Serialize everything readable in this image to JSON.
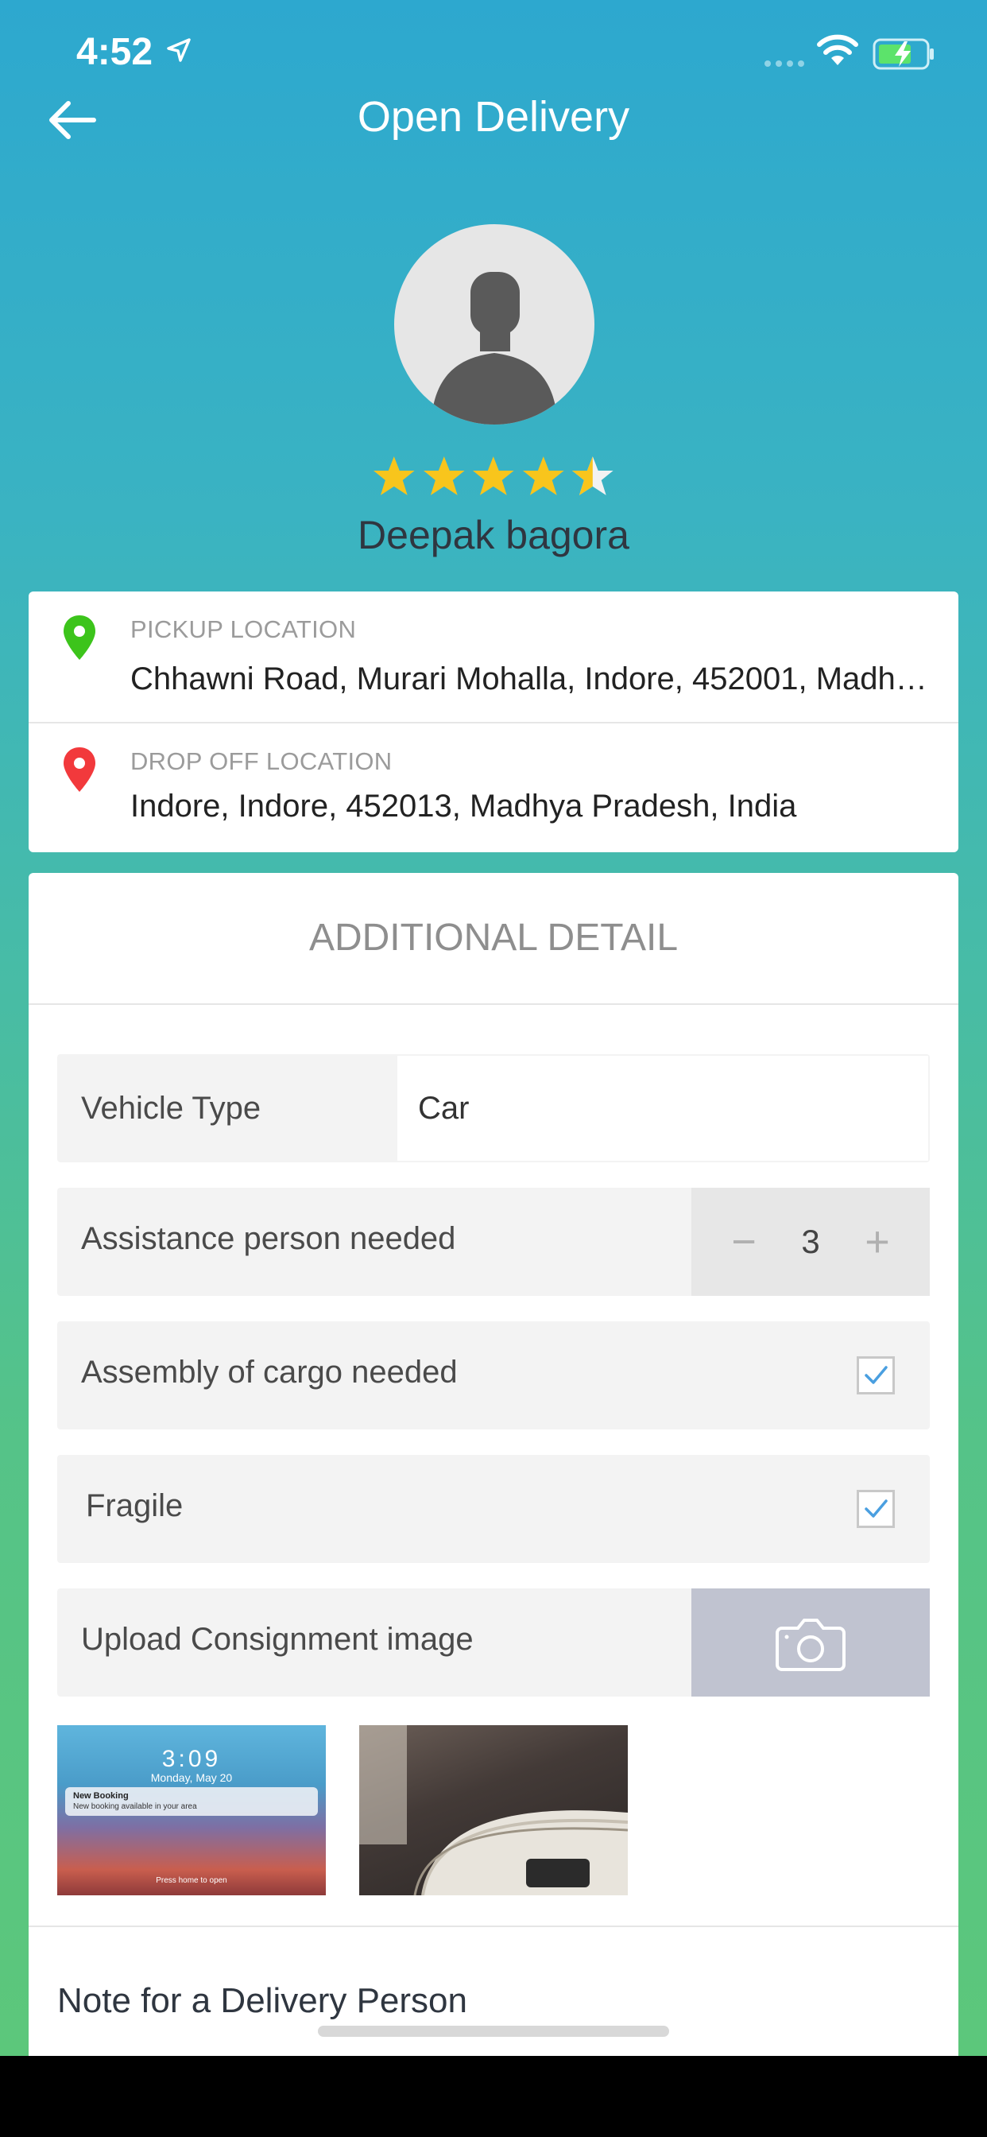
{
  "status_bar": {
    "time": "4:52"
  },
  "nav": {
    "title": "Open Delivery"
  },
  "profile": {
    "name": "Deepak bagora",
    "rating_stars": 4.5,
    "rating_max": 5
  },
  "pickup": {
    "label": "PICKUP LOCATION",
    "address": "Chhawni Road, Murari Mohalla, Indore, 452001, Madhya Pradesh, India"
  },
  "dropoff": {
    "label": "DROP OFF LOCATION",
    "address": "Indore, Indore, 452013, Madhya Pradesh, India"
  },
  "details": {
    "title": "ADDITIONAL DETAIL",
    "vehicle_type": {
      "label": "Vehicle Type",
      "value": "Car"
    },
    "assistance": {
      "label": "Assistance person needed",
      "value": "3",
      "minus": "−",
      "plus": "+"
    },
    "assembly": {
      "label": "Assembly of cargo needed",
      "checked": true
    },
    "fragile": {
      "label": "Fragile",
      "checked": true
    },
    "upload": {
      "label": "Upload Consignment image"
    },
    "thumbnails": [
      {
        "time": "3:09",
        "date": "Monday, May 20",
        "notif_title": "New Booking",
        "notif_text": "New booking available in your area",
        "hint": "Press home to open"
      },
      {
        "description": "photo"
      }
    ],
    "note_label": "Note for a Delivery Person"
  },
  "colors": {
    "accent": "#2da8cf",
    "pickup_pin": "#3cc41b",
    "dropoff_pin": "#f2393c",
    "star": "#f8c51c",
    "check": "#4a9fe0"
  }
}
